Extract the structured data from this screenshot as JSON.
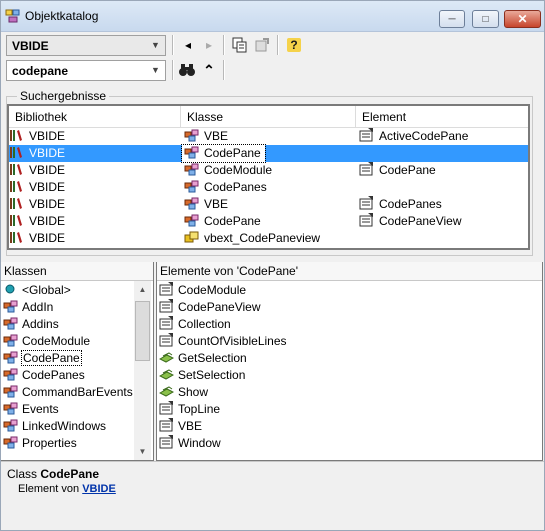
{
  "window": {
    "title": "Objektkatalog",
    "minimize_glyph": "─",
    "maximize_glyph": "□",
    "close_glyph": "✕"
  },
  "toolbar": {
    "library_value": "VBIDE",
    "search_value": "codepane",
    "back_glyph": "◂",
    "forward_glyph": "▸",
    "collapse_glyph": "⌃",
    "help_glyph": "?",
    "dropdown_glyph": "▼"
  },
  "search_results": {
    "legend": "Suchergebnisse",
    "columns": [
      "Bibliothek",
      "Klasse",
      "Element"
    ],
    "rows": [
      {
        "library": "VBIDE",
        "class": "VBE",
        "class_icon": "class-icon",
        "element": "ActiveCodePane",
        "element_icon": "property-icon"
      },
      {
        "library": "VBIDE",
        "class": "CodePane",
        "class_icon": "class-icon",
        "element": "",
        "element_icon": "",
        "selected": true
      },
      {
        "library": "VBIDE",
        "class": "CodeModule",
        "class_icon": "class-icon",
        "element": "CodePane",
        "element_icon": "property-icon"
      },
      {
        "library": "VBIDE",
        "class": "CodePanes",
        "class_icon": "class-icon",
        "element": "",
        "element_icon": ""
      },
      {
        "library": "VBIDE",
        "class": "VBE",
        "class_icon": "class-icon",
        "element": "CodePanes",
        "element_icon": "property-icon"
      },
      {
        "library": "VBIDE",
        "class": "CodePane",
        "class_icon": "class-icon",
        "element": "CodePaneView",
        "element_icon": "property-icon"
      },
      {
        "library": "VBIDE",
        "class": "vbext_CodePaneview",
        "class_icon": "enum-icon",
        "element": "",
        "element_icon": ""
      }
    ]
  },
  "classes": {
    "header": "Klassen",
    "items": [
      {
        "label": "<Global>",
        "icon": "global-icon"
      },
      {
        "label": "AddIn",
        "icon": "class-icon"
      },
      {
        "label": "Addins",
        "icon": "class-icon"
      },
      {
        "label": "CodeModule",
        "icon": "class-icon"
      },
      {
        "label": "CodePane",
        "icon": "class-icon",
        "focused": true
      },
      {
        "label": "CodePanes",
        "icon": "class-icon"
      },
      {
        "label": "CommandBarEvents",
        "icon": "class-icon"
      },
      {
        "label": "Events",
        "icon": "class-icon"
      },
      {
        "label": "LinkedWindows",
        "icon": "class-icon"
      },
      {
        "label": "Properties",
        "icon": "class-icon"
      }
    ]
  },
  "members": {
    "header": "Elemente von 'CodePane'",
    "items": [
      {
        "label": "CodeModule",
        "icon": "property-icon"
      },
      {
        "label": "CodePaneView",
        "icon": "property-icon"
      },
      {
        "label": "Collection",
        "icon": "property-icon"
      },
      {
        "label": "CountOfVisibleLines",
        "icon": "property-icon"
      },
      {
        "label": "GetSelection",
        "icon": "method-icon"
      },
      {
        "label": "SetSelection",
        "icon": "method-icon"
      },
      {
        "label": "Show",
        "icon": "method-icon"
      },
      {
        "label": "TopLine",
        "icon": "property-icon"
      },
      {
        "label": "VBE",
        "icon": "property-icon"
      },
      {
        "label": "Window",
        "icon": "property-icon"
      }
    ]
  },
  "details": {
    "kind": "Class",
    "name": "CodePane",
    "member_of_text": "Element von",
    "library_link": "VBIDE"
  },
  "colors": {
    "selection": "#3399ff",
    "link": "#0033aa"
  }
}
